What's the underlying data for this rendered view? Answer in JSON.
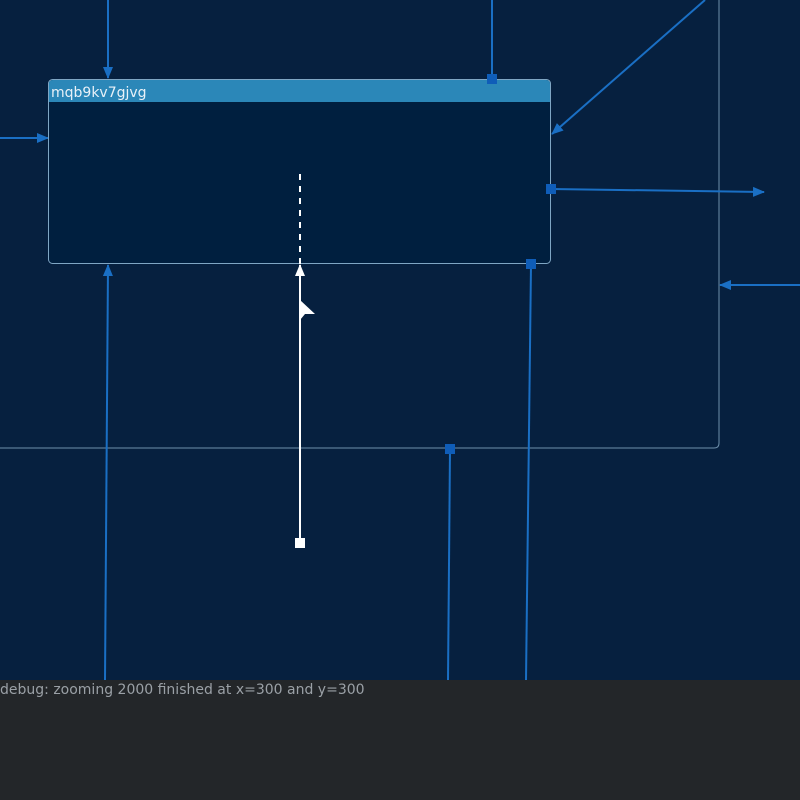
{
  "canvas": {
    "background": "#06203f",
    "edge_color": "#1a6fc4",
    "port_color": "#0f5db8",
    "active_color": "#ffffff"
  },
  "node": {
    "title": "mqb9kv7gjvg",
    "header_color": "#2b87b8",
    "body_color": "#001f3f",
    "border_color": "#7fa6c4"
  },
  "group": {
    "border_color": "#6d8fab"
  },
  "debug": {
    "text": "debug: zooming 2000 finished at x=300 and y=300"
  }
}
